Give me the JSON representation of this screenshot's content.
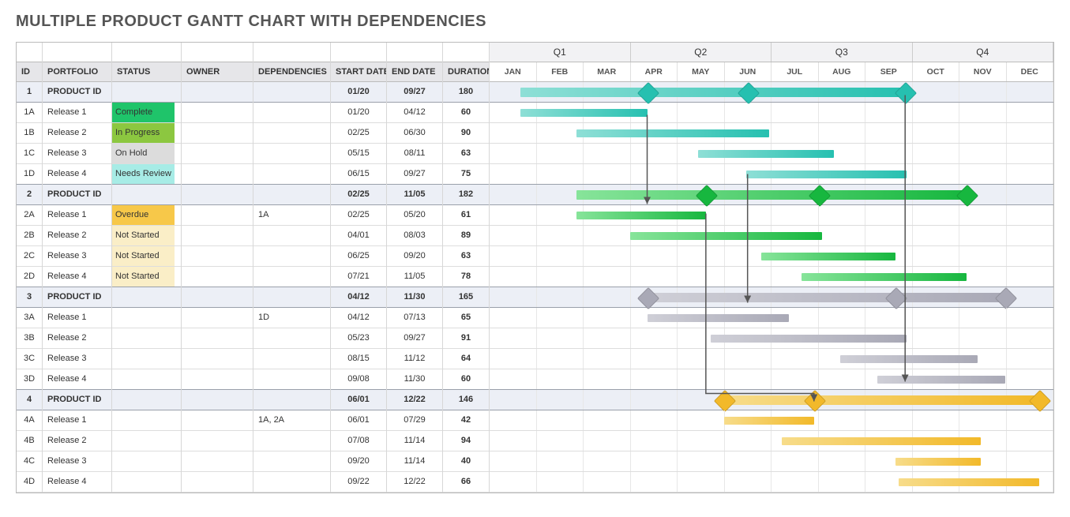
{
  "title": "MULTIPLE PRODUCT GANTT CHART WITH DEPENDENCIES",
  "columns": {
    "id": "ID",
    "portfolio": "PORTFOLIO",
    "status": "STATUS",
    "owner": "OWNER",
    "dep": "DEPENDENCIES",
    "start": "START DATE",
    "end": "END DATE",
    "dur": "DURATION"
  },
  "quarters": [
    "Q1",
    "Q2",
    "Q3",
    "Q4"
  ],
  "months": [
    "JAN",
    "FEB",
    "MAR",
    "APR",
    "MAY",
    "JUN",
    "JUL",
    "AUG",
    "SEP",
    "OCT",
    "NOV",
    "DEC"
  ],
  "status_colors": {
    "Complete": "#1fc46a",
    "In Progress": "#8cc740",
    "On Hold": "#dcdcdc",
    "Needs Review": "#a7ece6",
    "Overdue": "#f7c849",
    "Not Started": "#faeec7"
  },
  "product_colors": {
    "1": [
      "#8edfd6",
      "#26c0b0"
    ],
    "2": [
      "#87e49a",
      "#17b73f"
    ],
    "3": [
      "#cfcfd7",
      "#a9a9b6"
    ],
    "4": [
      "#f7dc8a",
      "#f2b92a"
    ]
  },
  "rows": [
    {
      "id": "1",
      "portfolio": "PRODUCT ID",
      "status": "",
      "owner": "",
      "dep": "",
      "start": "01/20",
      "end": "09/27",
      "dur": "180",
      "prod": true,
      "bar": [
        20,
        270
      ],
      "group": "1",
      "diamonds": [
        102,
        167,
        269
      ]
    },
    {
      "id": "1A",
      "portfolio": "Release 1",
      "status": "Complete",
      "owner": "",
      "dep": "",
      "start": "01/20",
      "end": "04/12",
      "dur": "60",
      "bar": [
        20,
        102
      ],
      "group": "1"
    },
    {
      "id": "1B",
      "portfolio": "Release 2",
      "status": "In Progress",
      "owner": "",
      "dep": "",
      "start": "02/25",
      "end": "06/30",
      "dur": "90",
      "bar": [
        56,
        181
      ],
      "group": "1"
    },
    {
      "id": "1C",
      "portfolio": "Release 3",
      "status": "On Hold",
      "owner": "",
      "dep": "",
      "start": "05/15",
      "end": "08/11",
      "dur": "63",
      "bar": [
        135,
        223
      ],
      "group": "1"
    },
    {
      "id": "1D",
      "portfolio": "Release 4",
      "status": "Needs Review",
      "owner": "",
      "dep": "",
      "start": "06/15",
      "end": "09/27",
      "dur": "75",
      "bar": [
        166,
        270
      ],
      "group": "1",
      "endgrp": true
    },
    {
      "id": "2",
      "portfolio": "PRODUCT ID",
      "status": "",
      "owner": "",
      "dep": "",
      "start": "02/25",
      "end": "11/05",
      "dur": "182",
      "prod": true,
      "bar": [
        56,
        309
      ],
      "group": "2",
      "diamonds": [
        140,
        213,
        309
      ]
    },
    {
      "id": "2A",
      "portfolio": "Release 1",
      "status": "Overdue",
      "owner": "",
      "dep": "1A",
      "start": "02/25",
      "end": "05/20",
      "dur": "61",
      "bar": [
        56,
        140
      ],
      "group": "2"
    },
    {
      "id": "2B",
      "portfolio": "Release 2",
      "status": "Not Started",
      "owner": "",
      "dep": "",
      "start": "04/01",
      "end": "08/03",
      "dur": "89",
      "bar": [
        91,
        215
      ],
      "group": "2"
    },
    {
      "id": "2C",
      "portfolio": "Release 3",
      "status": "Not Started",
      "owner": "",
      "dep": "",
      "start": "06/25",
      "end": "09/20",
      "dur": "63",
      "bar": [
        176,
        263
      ],
      "group": "2"
    },
    {
      "id": "2D",
      "portfolio": "Release 4",
      "status": "Not Started",
      "owner": "",
      "dep": "",
      "start": "07/21",
      "end": "11/05",
      "dur": "78",
      "bar": [
        202,
        309
      ],
      "group": "2",
      "endgrp": true
    },
    {
      "id": "3",
      "portfolio": "PRODUCT ID",
      "status": "",
      "owner": "",
      "dep": "",
      "start": "04/12",
      "end": "11/30",
      "dur": "165",
      "prod": true,
      "bar": [
        102,
        334
      ],
      "group": "3",
      "diamonds": [
        102,
        263,
        334
      ]
    },
    {
      "id": "3A",
      "portfolio": "Release 1",
      "status": "",
      "owner": "",
      "dep": "1D",
      "start": "04/12",
      "end": "07/13",
      "dur": "65",
      "bar": [
        102,
        194
      ],
      "group": "3"
    },
    {
      "id": "3B",
      "portfolio": "Release 2",
      "status": "",
      "owner": "",
      "dep": "",
      "start": "05/23",
      "end": "09/27",
      "dur": "91",
      "bar": [
        143,
        270
      ],
      "group": "3"
    },
    {
      "id": "3C",
      "portfolio": "Release 3",
      "status": "",
      "owner": "",
      "dep": "",
      "start": "08/15",
      "end": "11/12",
      "dur": "64",
      "bar": [
        227,
        316
      ],
      "group": "3"
    },
    {
      "id": "3D",
      "portfolio": "Release 4",
      "status": "",
      "owner": "",
      "dep": "",
      "start": "09/08",
      "end": "11/30",
      "dur": "60",
      "bar": [
        251,
        334
      ],
      "group": "3",
      "endgrp": true
    },
    {
      "id": "4",
      "portfolio": "PRODUCT ID",
      "status": "",
      "owner": "",
      "dep": "",
      "start": "06/01",
      "end": "12/22",
      "dur": "146",
      "prod": true,
      "bar": [
        152,
        356
      ],
      "group": "4",
      "diamonds": [
        152,
        210,
        356
      ]
    },
    {
      "id": "4A",
      "portfolio": "Release 1",
      "status": "",
      "owner": "",
      "dep": "1A, 2A",
      "start": "06/01",
      "end": "07/29",
      "dur": "42",
      "bar": [
        152,
        210
      ],
      "group": "4"
    },
    {
      "id": "4B",
      "portfolio": "Release 2",
      "status": "",
      "owner": "",
      "dep": "",
      "start": "07/08",
      "end": "11/14",
      "dur": "94",
      "bar": [
        189,
        318
      ],
      "group": "4"
    },
    {
      "id": "4C",
      "portfolio": "Release 3",
      "status": "",
      "owner": "",
      "dep": "",
      "start": "09/20",
      "end": "11/14",
      "dur": "40",
      "bar": [
        263,
        318
      ],
      "group": "4"
    },
    {
      "id": "4D",
      "portfolio": "Release 4",
      "status": "",
      "owner": "",
      "dep": "",
      "start": "09/22",
      "end": "12/22",
      "dur": "66",
      "bar": [
        265,
        356
      ],
      "group": "4"
    }
  ],
  "dependencies": [
    {
      "from": {
        "row": 1,
        "day": 102
      },
      "to": {
        "row": 6,
        "day": 102
      }
    },
    {
      "from": {
        "row": 4,
        "day": 167
      },
      "to": {
        "row": 11,
        "day": 167
      }
    },
    {
      "from": {
        "row": 6,
        "day": 140
      },
      "to": {
        "row": 16,
        "day": 210
      }
    },
    {
      "from": {
        "row": 0,
        "day": 269
      },
      "to": {
        "row": 15,
        "day": 269
      }
    }
  ],
  "chart_data": {
    "type": "gantt",
    "title": "Multiple Product Gantt Chart With Dependencies",
    "x_axis": {
      "unit": "month",
      "categories": [
        "JAN",
        "FEB",
        "MAR",
        "APR",
        "MAY",
        "JUN",
        "JUL",
        "AUG",
        "SEP",
        "OCT",
        "NOV",
        "DEC"
      ],
      "quarters": [
        "Q1",
        "Q2",
        "Q3",
        "Q4"
      ]
    },
    "series": [
      {
        "group": "Product 1",
        "id": "1",
        "name": "PRODUCT ID",
        "start": "01/20",
        "end": "09/27",
        "duration": 180,
        "summary": true,
        "milestones": [
          "04/12",
          "06/15",
          "09/27"
        ]
      },
      {
        "group": "Product 1",
        "id": "1A",
        "name": "Release 1",
        "start": "01/20",
        "end": "04/12",
        "duration": 60,
        "status": "Complete"
      },
      {
        "group": "Product 1",
        "id": "1B",
        "name": "Release 2",
        "start": "02/25",
        "end": "06/30",
        "duration": 90,
        "status": "In Progress"
      },
      {
        "group": "Product 1",
        "id": "1C",
        "name": "Release 3",
        "start": "05/15",
        "end": "08/11",
        "duration": 63,
        "status": "On Hold"
      },
      {
        "group": "Product 1",
        "id": "1D",
        "name": "Release 4",
        "start": "06/15",
        "end": "09/27",
        "duration": 75,
        "status": "Needs Review"
      },
      {
        "group": "Product 2",
        "id": "2",
        "name": "PRODUCT ID",
        "start": "02/25",
        "end": "11/05",
        "duration": 182,
        "summary": true,
        "milestones": [
          "05/20",
          "08/03",
          "11/05"
        ]
      },
      {
        "group": "Product 2",
        "id": "2A",
        "name": "Release 1",
        "start": "02/25",
        "end": "05/20",
        "duration": 61,
        "status": "Overdue",
        "depends_on": [
          "1A"
        ]
      },
      {
        "group": "Product 2",
        "id": "2B",
        "name": "Release 2",
        "start": "04/01",
        "end": "08/03",
        "duration": 89,
        "status": "Not Started"
      },
      {
        "group": "Product 2",
        "id": "2C",
        "name": "Release 3",
        "start": "06/25",
        "end": "09/20",
        "duration": 63,
        "status": "Not Started"
      },
      {
        "group": "Product 2",
        "id": "2D",
        "name": "Release 4",
        "start": "07/21",
        "end": "11/05",
        "duration": 78,
        "status": "Not Started"
      },
      {
        "group": "Product 3",
        "id": "3",
        "name": "PRODUCT ID",
        "start": "04/12",
        "end": "11/30",
        "duration": 165,
        "summary": true,
        "milestones": [
          "04/12",
          "09/20",
          "11/30"
        ]
      },
      {
        "group": "Product 3",
        "id": "3A",
        "name": "Release 1",
        "start": "04/12",
        "end": "07/13",
        "duration": 65,
        "depends_on": [
          "1D"
        ]
      },
      {
        "group": "Product 3",
        "id": "3B",
        "name": "Release 2",
        "start": "05/23",
        "end": "09/27",
        "duration": 91
      },
      {
        "group": "Product 3",
        "id": "3C",
        "name": "Release 3",
        "start": "08/15",
        "end": "11/12",
        "duration": 64
      },
      {
        "group": "Product 3",
        "id": "3D",
        "name": "Release 4",
        "start": "09/08",
        "end": "11/30",
        "duration": 60
      },
      {
        "group": "Product 4",
        "id": "4",
        "name": "PRODUCT ID",
        "start": "06/01",
        "end": "12/22",
        "duration": 146,
        "summary": true,
        "milestones": [
          "06/01",
          "07/29",
          "12/22"
        ]
      },
      {
        "group": "Product 4",
        "id": "4A",
        "name": "Release 1",
        "start": "06/01",
        "end": "07/29",
        "duration": 42,
        "depends_on": [
          "1A",
          "2A"
        ]
      },
      {
        "group": "Product 4",
        "id": "4B",
        "name": "Release 2",
        "start": "07/08",
        "end": "11/14",
        "duration": 94
      },
      {
        "group": "Product 4",
        "id": "4C",
        "name": "Release 3",
        "start": "09/20",
        "end": "11/14",
        "duration": 40
      },
      {
        "group": "Product 4",
        "id": "4D",
        "name": "Release 4",
        "start": "09/22",
        "end": "12/22",
        "duration": 66
      }
    ],
    "dependencies": [
      [
        "1A",
        "2A"
      ],
      [
        "1D",
        "3A"
      ],
      [
        "2A",
        "4A"
      ],
      [
        "1",
        "4"
      ]
    ]
  }
}
